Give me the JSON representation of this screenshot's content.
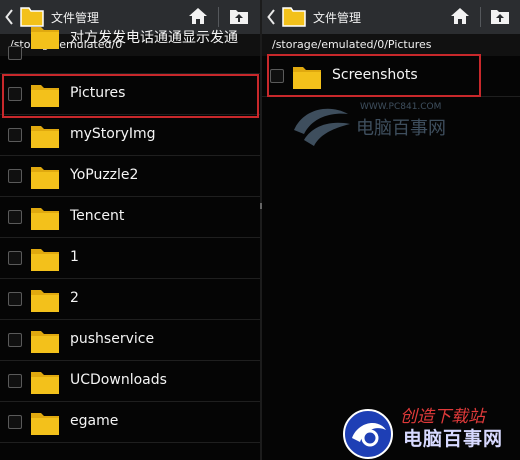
{
  "left_pane": {
    "title": "文件管理",
    "path": "/storage/emulated/0",
    "items": [
      {
        "name": "对方发发电话通通显示发通"
      },
      {
        "name": "Pictures"
      },
      {
        "name": "myStoryImg"
      },
      {
        "name": "YoPuzzle2"
      },
      {
        "name": "Tencent"
      },
      {
        "name": "1"
      },
      {
        "name": "2"
      },
      {
        "name": "pushservice"
      },
      {
        "name": "UCDownloads"
      },
      {
        "name": "egame"
      }
    ]
  },
  "right_pane": {
    "title": "文件管理",
    "path": "/storage/emulated/0/Pictures",
    "items": [
      {
        "name": "Screenshots"
      }
    ]
  },
  "icons": {
    "back": "back-arrow-icon",
    "app": "folder-icon",
    "home": "home-icon",
    "up": "folder-up-icon",
    "item": "folder-icon"
  },
  "colors": {
    "appbar": "#2b2d30",
    "folder": "#f3c11b",
    "highlight": "#c8282b",
    "background": "#050505"
  },
  "watermark": {
    "url": "WWW.PC841.COM",
    "text": "电脑百事网"
  },
  "corner_logo": {
    "slogan": "创造下载站",
    "brand": "电脑百事网"
  }
}
